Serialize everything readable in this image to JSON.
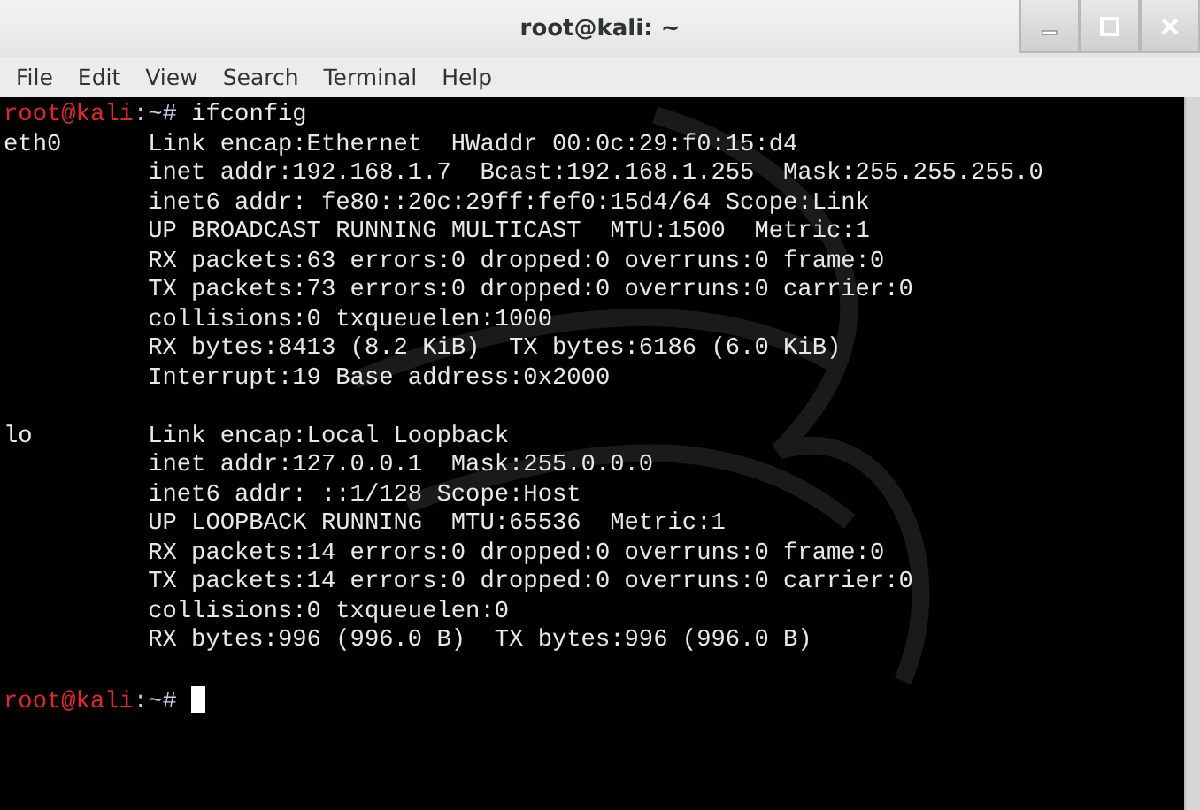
{
  "window": {
    "title": "root@kali: ~"
  },
  "menu": [
    "File",
    "Edit",
    "View",
    "Search",
    "Terminal",
    "Help"
  ],
  "terminal": {
    "lines": [
      {
        "kind": "prompt",
        "user": "root@kali",
        "path": ":~#",
        "command": "ifconfig",
        "cursor": false
      },
      {
        "kind": "output",
        "text": "eth0      Link encap:Ethernet  HWaddr 00:0c:29:f0:15:d4"
      },
      {
        "kind": "output",
        "text": "          inet addr:192.168.1.7  Bcast:192.168.1.255  Mask:255.255.255.0"
      },
      {
        "kind": "output",
        "text": "          inet6 addr: fe80::20c:29ff:fef0:15d4/64 Scope:Link"
      },
      {
        "kind": "output",
        "text": "          UP BROADCAST RUNNING MULTICAST  MTU:1500  Metric:1"
      },
      {
        "kind": "output",
        "text": "          RX packets:63 errors:0 dropped:0 overruns:0 frame:0"
      },
      {
        "kind": "output",
        "text": "          TX packets:73 errors:0 dropped:0 overruns:0 carrier:0"
      },
      {
        "kind": "output",
        "text": "          collisions:0 txqueuelen:1000"
      },
      {
        "kind": "output",
        "text": "          RX bytes:8413 (8.2 KiB)  TX bytes:6186 (6.0 KiB)"
      },
      {
        "kind": "output",
        "text": "          Interrupt:19 Base address:0x2000"
      },
      {
        "kind": "blank"
      },
      {
        "kind": "output",
        "text": "lo        Link encap:Local Loopback"
      },
      {
        "kind": "output",
        "text": "          inet addr:127.0.0.1  Mask:255.0.0.0"
      },
      {
        "kind": "output",
        "text": "          inet6 addr: ::1/128 Scope:Host"
      },
      {
        "kind": "output",
        "text": "          UP LOOPBACK RUNNING  MTU:65536  Metric:1"
      },
      {
        "kind": "output",
        "text": "          RX packets:14 errors:0 dropped:0 overruns:0 frame:0"
      },
      {
        "kind": "output",
        "text": "          TX packets:14 errors:0 dropped:0 overruns:0 carrier:0"
      },
      {
        "kind": "output",
        "text": "          collisions:0 txqueuelen:0"
      },
      {
        "kind": "output",
        "text": "          RX bytes:996 (996.0 B)  TX bytes:996 (996.0 B)"
      },
      {
        "kind": "blank"
      },
      {
        "kind": "prompt",
        "user": "root@kali",
        "path": ":~#",
        "cursor": true
      }
    ]
  }
}
